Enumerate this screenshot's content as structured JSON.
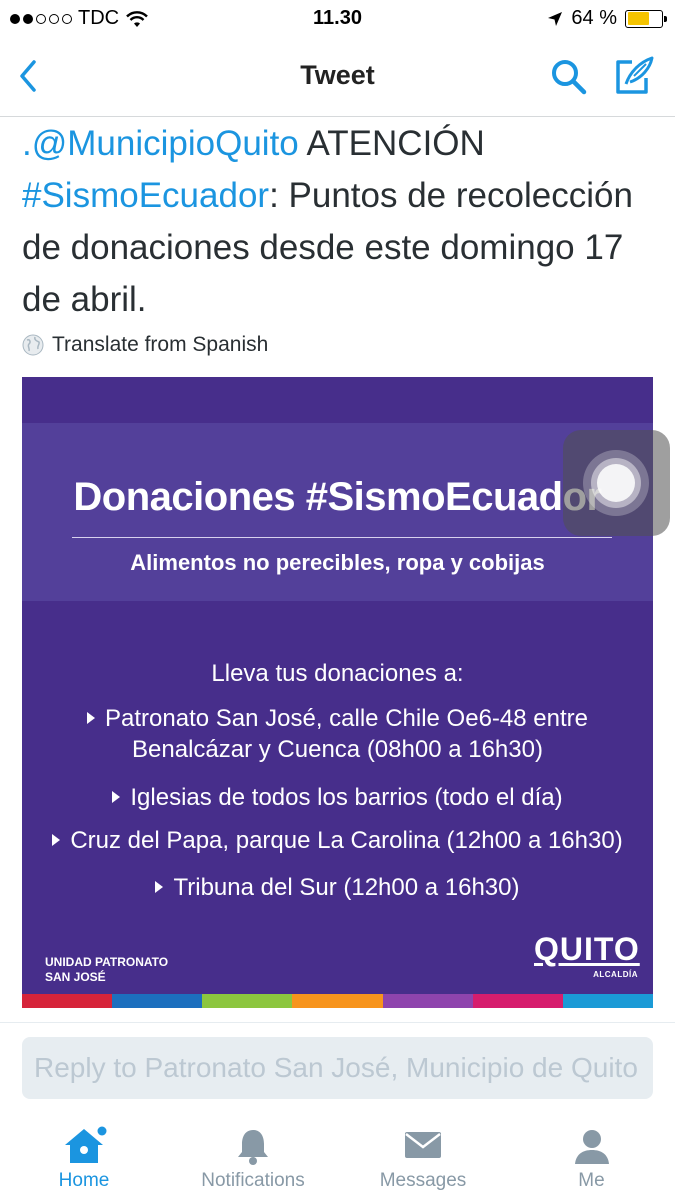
{
  "status_bar": {
    "carrier": "TDC",
    "time": "11.30",
    "battery_percent": "64 %",
    "battery_level": 0.64,
    "signal_bars": 2
  },
  "nav": {
    "title": "Tweet"
  },
  "tweet": {
    "mention": ".@MunicipioQuito",
    "text_1": " ATENCIÓN ",
    "hashtag": "#SismoEcuador",
    "text_2": ": Puntos de recolección de donaciones desde este domingo 17 de abril.",
    "translate_label": "Translate from Spanish"
  },
  "media": {
    "headline": "Donaciones #SismoEcuador",
    "subheadline": "Alimentos no perecibles, ropa y cobijas",
    "intro": "Lleva tus donaciones a:",
    "items": [
      {
        "line1": "Patronato San José, calle Chile Oe6-48 entre",
        "line2": "Benalcázar y Cuenca (08h00 a 16h30)"
      },
      {
        "line1": "Iglesias de todos los barrios (todo el día)"
      },
      {
        "line1": "Cruz del Papa, parque La Carolina (12h00 a 16h30)"
      },
      {
        "line1": "Tribuna del Sur (12h00 a 16h30)"
      }
    ],
    "org_line1": "UNIDAD PATRONATO",
    "org_line2": "SAN JOSÉ",
    "logo_word": "QUITO",
    "logo_sub": "ALCALDÍA",
    "stripe_colors": [
      "#d6243a",
      "#1c6fbe",
      "#8cc63f",
      "#f7941d",
      "#8e44ad",
      "#d61d6d",
      "#1b9ad6"
    ]
  },
  "reply": {
    "placeholder": "Reply to Patronato San José, Municipio de Quito"
  },
  "tabs": [
    {
      "label": "Home",
      "icon": "home-icon",
      "active": true
    },
    {
      "label": "Notifications",
      "icon": "bell-icon",
      "active": false
    },
    {
      "label": "Messages",
      "icon": "envelope-icon",
      "active": false
    },
    {
      "label": "Me",
      "icon": "person-icon",
      "active": false
    }
  ],
  "colors": {
    "accent": "#1b95e0",
    "media_bg": "#472e8b"
  }
}
